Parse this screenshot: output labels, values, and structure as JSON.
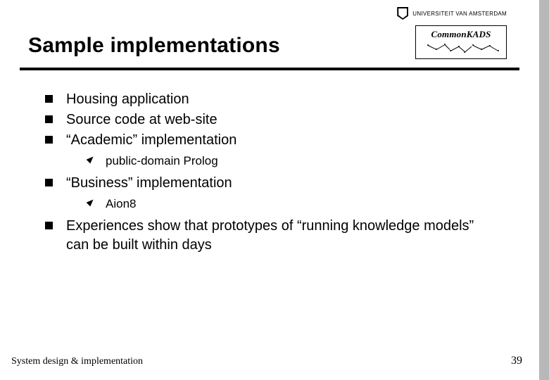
{
  "header": {
    "title": "Sample implementations",
    "logo_uva_text": "UNIVERSITEIT VAN AMSTERDAM",
    "logo_ck_text": "CommonKADS"
  },
  "bullets": {
    "items": [
      {
        "text": "Housing application",
        "sub": []
      },
      {
        "text": "Source code at web-site",
        "sub": []
      },
      {
        "text": "“Academic” implementation",
        "sub": [
          "public-domain Prolog"
        ]
      },
      {
        "text": "“Business” implementation",
        "sub": [
          "Aion8"
        ]
      },
      {
        "text": "Experiences show that  prototypes of “running knowledge models” can be built within days",
        "sub": []
      }
    ]
  },
  "footer": {
    "left": "System design & implementation",
    "page": "39"
  }
}
